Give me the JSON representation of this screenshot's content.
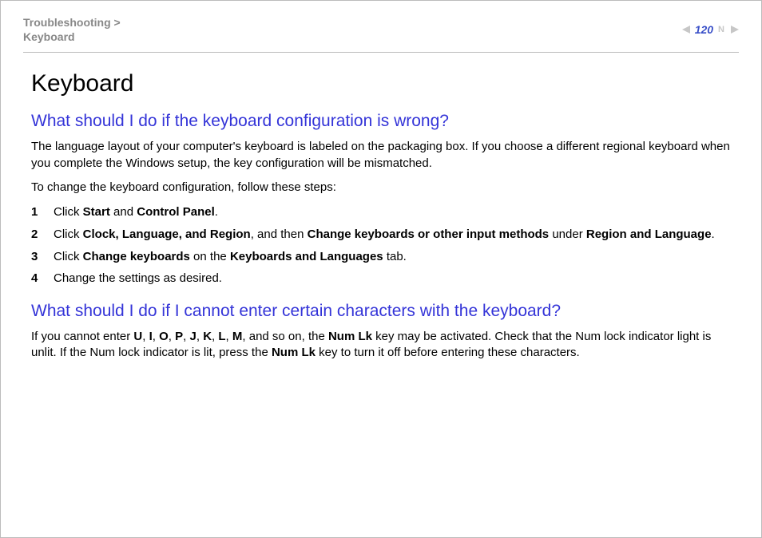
{
  "breadcrumb": {
    "line1": "Troubleshooting >",
    "line2": "Keyboard"
  },
  "page_label": "N",
  "page_number": "120",
  "title": "Keyboard",
  "section1": {
    "heading": "What should I do if the keyboard configuration is wrong?",
    "para1": "The language layout of your computer's keyboard is labeled on the packaging box. If you choose a different regional keyboard when you complete the Windows setup, the key configuration will be mismatched.",
    "para2": "To change the keyboard configuration, follow these steps:",
    "steps": {
      "s1": {
        "pre": "Click ",
        "b1": "Start",
        "mid": " and ",
        "b2": "Control Panel",
        "post": "."
      },
      "s2": {
        "pre": "Click ",
        "b1": "Clock, Language, and Region",
        "mid1": ", and then ",
        "b2": "Change keyboards or other input methods",
        "mid2": " under ",
        "b3": "Region and Language",
        "post": "."
      },
      "s3": {
        "pre": "Click ",
        "b1": "Change keyboards",
        "mid": " on the ",
        "b2": "Keyboards and Languages",
        "post": " tab."
      },
      "s4": {
        "text": "Change the settings as desired."
      }
    }
  },
  "section2": {
    "heading": "What should I do if I cannot enter certain characters with the keyboard?",
    "para": {
      "pre": "If you cannot enter ",
      "k1": "U",
      "c1": ", ",
      "k2": "I",
      "c2": ", ",
      "k3": "O",
      "c3": ", ",
      "k4": "P",
      "c4": ", ",
      "k5": "J",
      "c5": ", ",
      "k6": "K",
      "c6": ", ",
      "k7": "L",
      "c7": ", ",
      "k8": "M",
      "mid1": ", and so on, the ",
      "numlk1": "Num Lk",
      "mid2": " key may be activated. Check that the Num lock indicator light is unlit. If the Num lock indicator is lit, press the ",
      "numlk2": "Num Lk",
      "post": " key to turn it off before entering these characters."
    }
  }
}
